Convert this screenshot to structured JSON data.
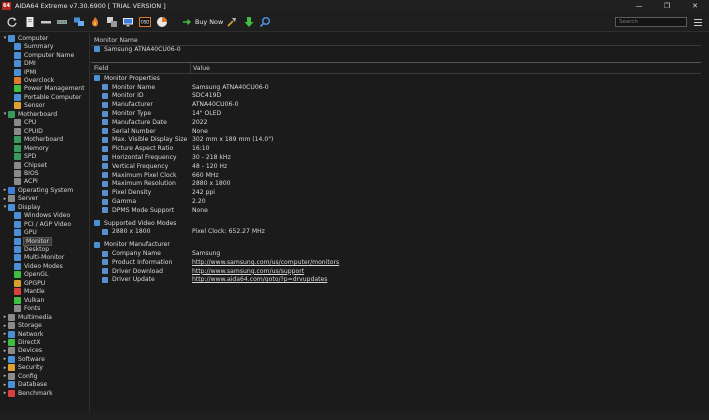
{
  "window": {
    "app_icon_text": "64",
    "title": "AIDA64 Extreme v7.30.6900  [ TRIAL VERSION ]",
    "minimize": "—",
    "maximize": "❐",
    "close": "✕"
  },
  "toolbar": {
    "buy_now": "Buy Now",
    "search_placeholder": "Search",
    "icons": [
      "refresh-icon",
      "report-icon",
      "usb-icon",
      "memory-icon",
      "network-icon",
      "flame-icon",
      "tools-icon",
      "monitor-icon",
      "osd-icon",
      "benchmark-icon",
      "buy-icon",
      "wrench-icon",
      "download-icon",
      "search-icon"
    ]
  },
  "tree": [
    {
      "label": "Computer",
      "level": 0,
      "exp": "▾",
      "color": "#4a90d9"
    },
    {
      "label": "Summary",
      "level": 1,
      "color": "#4a90d9"
    },
    {
      "label": "Computer Name",
      "level": 1,
      "color": "#4a90d9"
    },
    {
      "label": "DMI",
      "level": 1,
      "color": "#4a90d9"
    },
    {
      "label": "IPMI",
      "level": 1,
      "color": "#4a90d9"
    },
    {
      "label": "Overclock",
      "level": 1,
      "color": "#e07a2a"
    },
    {
      "label": "Power Management",
      "level": 1,
      "color": "#3fbf3f"
    },
    {
      "label": "Portable Computer",
      "level": 1,
      "color": "#4a90d9"
    },
    {
      "label": "Sensor",
      "level": 1,
      "color": "#e0a030"
    },
    {
      "label": "Motherboard",
      "level": 0,
      "exp": "▾",
      "color": "#3a9a5a"
    },
    {
      "label": "CPU",
      "level": 1,
      "color": "#8a8a8a"
    },
    {
      "label": "CPUID",
      "level": 1,
      "color": "#8a8a8a"
    },
    {
      "label": "Motherboard",
      "level": 1,
      "color": "#3a9a5a"
    },
    {
      "label": "Memory",
      "level": 1,
      "color": "#3a9a5a"
    },
    {
      "label": "SPD",
      "level": 1,
      "color": "#3a9a5a"
    },
    {
      "label": "Chipset",
      "level": 1,
      "color": "#8a8a8a"
    },
    {
      "label": "BIOS",
      "level": 1,
      "color": "#8a8a8a"
    },
    {
      "label": "ACPI",
      "level": 1,
      "color": "#8a8a8a"
    },
    {
      "label": "Operating System",
      "level": 0,
      "exp": "▸",
      "color": "#3a7fd9"
    },
    {
      "label": "Server",
      "level": 0,
      "exp": "▸",
      "color": "#8a8a8a"
    },
    {
      "label": "Display",
      "level": 0,
      "exp": "▾",
      "color": "#4a90d9"
    },
    {
      "label": "Windows Video",
      "level": 1,
      "color": "#4a90d9"
    },
    {
      "label": "PCI / AGP Video",
      "level": 1,
      "color": "#4a90d9"
    },
    {
      "label": "GPU",
      "level": 1,
      "color": "#4a90d9"
    },
    {
      "label": "Monitor",
      "level": 1,
      "color": "#4a90d9",
      "selected": true
    },
    {
      "label": "Desktop",
      "level": 1,
      "color": "#4a90d9"
    },
    {
      "label": "Multi-Monitor",
      "level": 1,
      "color": "#4a90d9"
    },
    {
      "label": "Video Modes",
      "level": 1,
      "color": "#4a90d9"
    },
    {
      "label": "OpenGL",
      "level": 1,
      "color": "#3fbf3f"
    },
    {
      "label": "GPGPU",
      "level": 1,
      "color": "#d9a030"
    },
    {
      "label": "Mantle",
      "level": 1,
      "color": "#d94040"
    },
    {
      "label": "Vulkan",
      "level": 1,
      "color": "#3fbf3f"
    },
    {
      "label": "Fonts",
      "level": 1,
      "color": "#8a8a8a"
    },
    {
      "label": "Multimedia",
      "level": 0,
      "exp": "▸",
      "color": "#8a8a8a"
    },
    {
      "label": "Storage",
      "level": 0,
      "exp": "▸",
      "color": "#8a8a8a"
    },
    {
      "label": "Network",
      "level": 0,
      "exp": "▸",
      "color": "#4a90d9"
    },
    {
      "label": "DirectX",
      "level": 0,
      "exp": "▸",
      "color": "#3fbf3f"
    },
    {
      "label": "Devices",
      "level": 0,
      "exp": "▸",
      "color": "#8a8a8a"
    },
    {
      "label": "Software",
      "level": 0,
      "exp": "▸",
      "color": "#4a90d9"
    },
    {
      "label": "Security",
      "level": 0,
      "exp": "▸",
      "color": "#e0a030"
    },
    {
      "label": "Config",
      "level": 0,
      "exp": "▸",
      "color": "#8a8a8a"
    },
    {
      "label": "Database",
      "level": 0,
      "exp": "▸",
      "color": "#4a90d9"
    },
    {
      "label": "Benchmark",
      "level": 0,
      "exp": "▸",
      "color": "#d94040"
    }
  ],
  "monitor_name_header": "Monitor Name",
  "monitor_name_value": "Samsung ATNA40CU06-0",
  "columns": {
    "field": "Field",
    "value": "Value"
  },
  "sections": [
    {
      "title": "Monitor Properties",
      "rows": [
        {
          "field": "Monitor Name",
          "value": "Samsung ATNA40CU06-0"
        },
        {
          "field": "Monitor ID",
          "value": "SDC419D"
        },
        {
          "field": "Manufacturer",
          "value": "ATNA40CU06-0"
        },
        {
          "field": "Monitor Type",
          "value": "14\" OLED"
        },
        {
          "field": "Manufacture Date",
          "value": "2022"
        },
        {
          "field": "Serial Number",
          "value": "None"
        },
        {
          "field": "Max. Visible Display Size",
          "value": "302 mm x 189 mm (14.0\")"
        },
        {
          "field": "Picture Aspect Ratio",
          "value": "16:10"
        },
        {
          "field": "Horizontal Frequency",
          "value": "30 - 218 kHz"
        },
        {
          "field": "Vertical Frequency",
          "value": "48 - 120 Hz"
        },
        {
          "field": "Maximum Pixel Clock",
          "value": "660 MHz"
        },
        {
          "field": "Maximum Resolution",
          "value": "2880 x 1800"
        },
        {
          "field": "Pixel Density",
          "value": "242 ppi"
        },
        {
          "field": "Gamma",
          "value": "2.20"
        },
        {
          "field": "DPMS Mode Support",
          "value": "None"
        }
      ]
    },
    {
      "title": "Supported Video Modes",
      "rows": [
        {
          "field": "2880 x 1800",
          "value": "Pixel Clock: 652.27 MHz"
        }
      ]
    },
    {
      "title": "Monitor Manufacturer",
      "rows": [
        {
          "field": "Company Name",
          "value": "Samsung"
        },
        {
          "field": "Product Information",
          "value": "http://www.samsung.com/us/computer/monitors",
          "link": true
        },
        {
          "field": "Driver Download",
          "value": "http://www.samsung.com/us/support",
          "link": true
        },
        {
          "field": "Driver Update",
          "value": "http://www.aida64.com/goto/?p=drvupdates",
          "link": true
        }
      ]
    }
  ]
}
